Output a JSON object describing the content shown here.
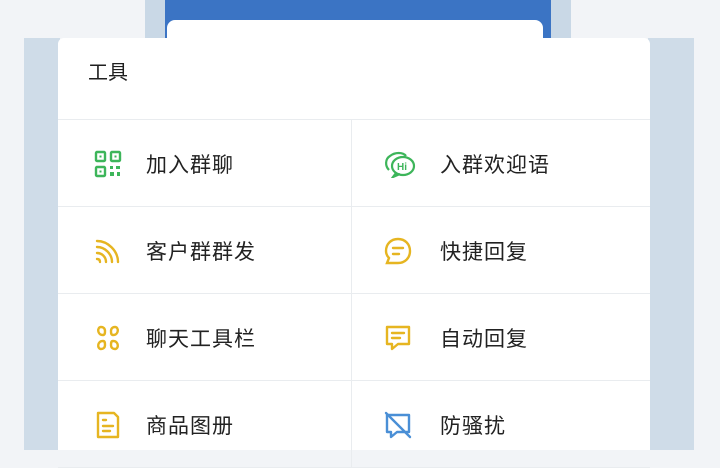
{
  "panel": {
    "title": "工具"
  },
  "tools": [
    {
      "label": "加入群聊",
      "icon": "qr-code-icon",
      "color": "#3db55a"
    },
    {
      "label": "入群欢迎语",
      "icon": "hi-chat-icon",
      "color": "#3db55a"
    },
    {
      "label": "客户群群发",
      "icon": "broadcast-icon",
      "color": "#e6b521"
    },
    {
      "label": "快捷回复",
      "icon": "quick-reply-icon",
      "color": "#e6b521"
    },
    {
      "label": "聊天工具栏",
      "icon": "toolbar-icon",
      "color": "#e6b521"
    },
    {
      "label": "自动回复",
      "icon": "auto-reply-icon",
      "color": "#e6b521"
    },
    {
      "label": "商品图册",
      "icon": "catalog-icon",
      "color": "#e6b521"
    },
    {
      "label": "防骚扰",
      "icon": "anti-spam-icon",
      "color": "#4a8fd6"
    }
  ]
}
